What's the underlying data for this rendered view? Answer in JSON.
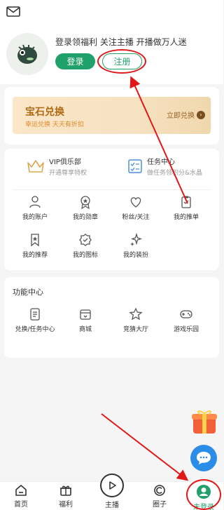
{
  "header": {
    "promo_text": "登录领福利 关注主播 开播做万人迷",
    "login_label": "登录",
    "register_label": "注册"
  },
  "gem": {
    "title": "宝石兑换",
    "subtitle": "幸运兑换 天天有折扣",
    "action": "立即兑换"
  },
  "menu": {
    "vip": {
      "title": "VIP俱乐部",
      "subtitle": "开通尊享特权"
    },
    "task": {
      "title": "任务中心",
      "subtitle": "做任务领积分&水晶"
    },
    "row1": [
      {
        "label": "我的账户",
        "icon": "account-icon"
      },
      {
        "label": "我的勋章",
        "icon": "medal-icon"
      },
      {
        "label": "粉丝/关注",
        "icon": "fans-icon"
      },
      {
        "label": "我的推单",
        "icon": "clipboard-icon"
      }
    ],
    "row2": [
      {
        "label": "我的推荐",
        "icon": "bookmark-star-icon"
      },
      {
        "label": "我的图标",
        "icon": "badge-check-icon"
      },
      {
        "label": "我的装扮",
        "icon": "sparkle-icon"
      }
    ]
  },
  "functions": {
    "title": "功能中心",
    "items": [
      {
        "label": "兑换/任务中心",
        "icon": "exchange-task-icon"
      },
      {
        "label": "商城",
        "icon": "shop-icon"
      },
      {
        "label": "竞猜大厅",
        "icon": "guess-icon"
      },
      {
        "label": "游戏乐园",
        "icon": "gamepad-icon"
      }
    ]
  },
  "tabs": [
    {
      "label": "首页",
      "icon": "home-icon"
    },
    {
      "label": "福利",
      "icon": "gift-icon"
    },
    {
      "label": "主播",
      "icon": "play-icon"
    },
    {
      "label": "圈子",
      "icon": "circle-icon"
    },
    {
      "label": "未登录",
      "icon": "user-icon"
    }
  ],
  "colors": {
    "brand_green": "#20a06a",
    "annotation_red": "#e01818",
    "chat_blue": "#2b8de8"
  }
}
